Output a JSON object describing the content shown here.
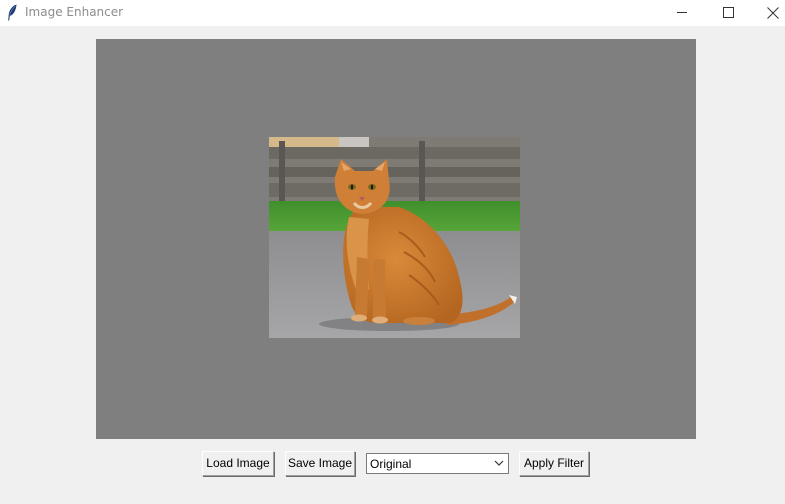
{
  "window": {
    "title": "Image Enhancer",
    "icon": "feather-icon",
    "controls": [
      "minimize-icon",
      "maximize-icon",
      "close-icon"
    ]
  },
  "canvas": {
    "background": "#7f7f7f",
    "image": "orange tabby cat sitting on pavement"
  },
  "toolbar": {
    "load_label": "Load Image",
    "save_label": "Save Image",
    "filter_selected": "Original",
    "apply_label": "Apply Filter"
  }
}
